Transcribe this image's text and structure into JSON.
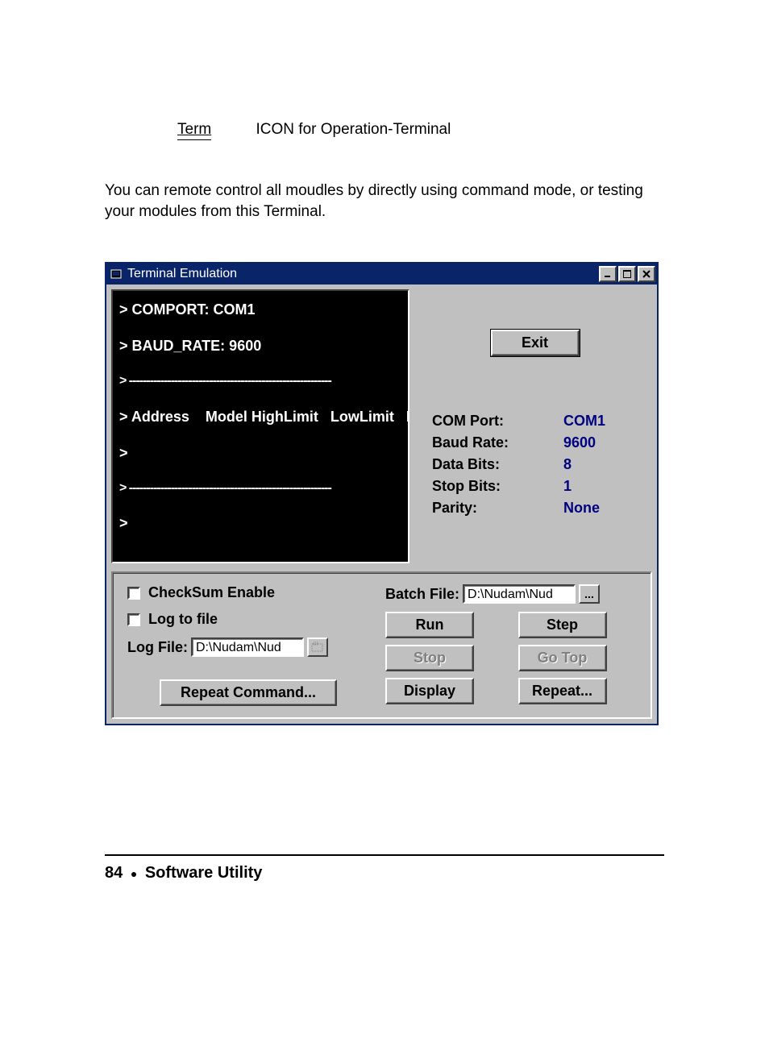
{
  "doc": {
    "term_label": "Term",
    "term_desc": "ICON for Operation-Terminal",
    "paragraph": "You can remote control all moudles by directly using command mode, or testing your modules from this Terminal."
  },
  "window": {
    "title": "Terminal Emulation"
  },
  "terminal": {
    "line1": "> COMPORT: COM1",
    "blank": " ",
    "line2": "> BAUD_RATE: 9600",
    "sep": "> ----------------------------------------------------------",
    "line3": "> Address    Model HighLimit   LowLimit   F",
    "prompt": ">"
  },
  "buttons": {
    "exit": "Exit",
    "repeat_cmd": "Repeat Command...",
    "run": "Run",
    "step": "Step",
    "stop": "Stop",
    "gotop": "Go Top",
    "display": "Display",
    "repeat": "Repeat..."
  },
  "params": {
    "com_port_label": "COM Port:",
    "com_port_value": "COM1",
    "baud_rate_label": "Baud Rate:",
    "baud_rate_value": "9600",
    "data_bits_label": "Data Bits:",
    "data_bits_value": "8",
    "stop_bits_label": "Stop Bits:",
    "stop_bits_value": "1",
    "parity_label": "Parity:",
    "parity_value": "None"
  },
  "lower": {
    "checksum": "CheckSum Enable",
    "logtofile": "Log to file",
    "logfile_label": "Log File:",
    "logfile_value": "D:\\Nudam\\Nud",
    "batchfile_label": "Batch File:",
    "batchfile_value": "D:\\Nudam\\Nud"
  },
  "footer": {
    "page_num": "84",
    "section": "Software Utility"
  }
}
